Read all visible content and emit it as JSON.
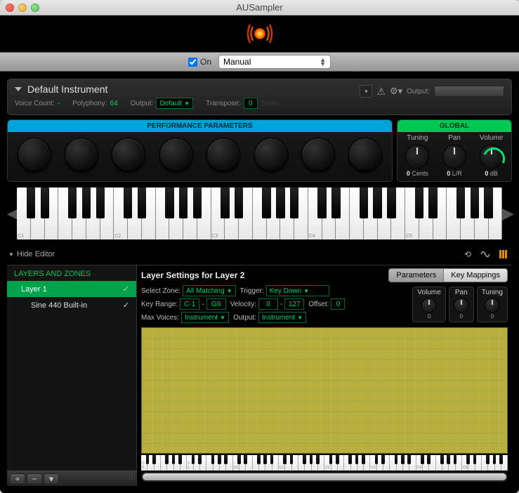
{
  "window": {
    "title": "AUSampler"
  },
  "toolbar": {
    "on_label": "On",
    "mode": "Manual"
  },
  "instrument": {
    "name": "Default Instrument",
    "voice_count_label": "Voice Count:",
    "voice_count_value": "-",
    "polyphony_label": "Polyphony:",
    "polyphony_value": "64",
    "output_label": "Output:",
    "output_value": "Default",
    "transpose_label": "Transpose:",
    "transpose_value": "0",
    "steps_label": "Steps",
    "output_right_label": "Output:"
  },
  "pp": {
    "title": "PERFORMANCE PARAMETERS"
  },
  "global": {
    "title": "GLOBAL",
    "cols": [
      {
        "label": "Tuning",
        "value": "0",
        "unit": "Cents"
      },
      {
        "label": "Pan",
        "value": "0",
        "unit": "L/R"
      },
      {
        "label": "Volume",
        "value": "0",
        "unit": "dB"
      }
    ]
  },
  "piano_labels": [
    "C1",
    "C2",
    "C3",
    "C4",
    "C5"
  ],
  "editor_toggle": "Hide Editor",
  "sidebar": {
    "title": "LAYERS AND ZONES",
    "items": [
      {
        "label": "Layer 1",
        "checked": true
      },
      {
        "label": "Sine 440 Built-in",
        "checked": true
      }
    ]
  },
  "layer": {
    "title": "Layer Settings for Layer 2",
    "tabs": [
      "Parameters",
      "Key Mappings"
    ],
    "select_zone_label": "Select Zone:",
    "select_zone_value": "All Matching",
    "trigger_label": "Trigger:",
    "trigger_value": "Key Down",
    "key_range_label": "Key Range:",
    "key_range_lo": "C-1",
    "key_range_hi": "G9",
    "velocity_label": "Velocity:",
    "velocity_lo": "0",
    "velocity_hi": "127",
    "offset_label": "Offset:",
    "offset_value": "0",
    "max_voices_label": "Max Voices:",
    "max_voices_value": "Instrument",
    "output_label": "Output:",
    "output_value": "Instrument",
    "knobs": [
      {
        "label": "Volume",
        "value": "0"
      },
      {
        "label": "Pan",
        "value": "0"
      },
      {
        "label": "Tuning",
        "value": "0"
      }
    ]
  },
  "mini_piano_labels": [
    "C-2",
    "C-1",
    "C0",
    "C1",
    "C2",
    "C3",
    "C4",
    "C5"
  ]
}
